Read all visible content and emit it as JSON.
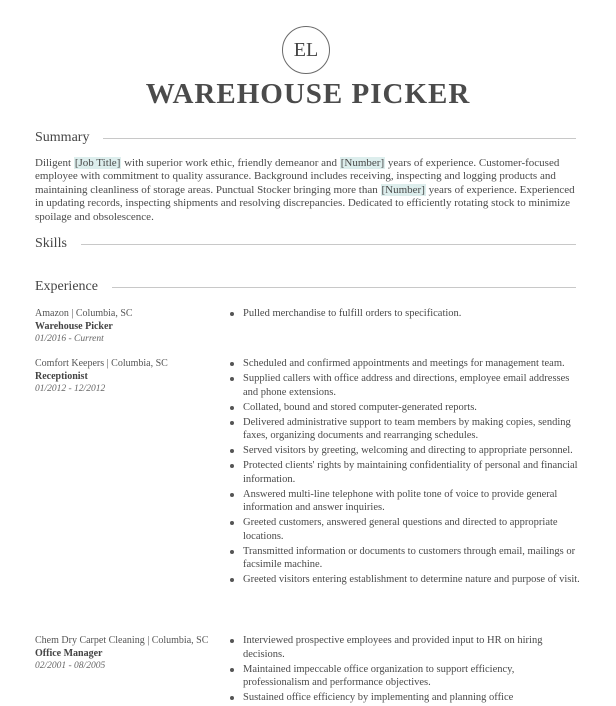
{
  "header": {
    "monogram": "EL",
    "title": "WAREHOUSE PICKER"
  },
  "sections": {
    "summary": "Summary",
    "skills": "Skills",
    "experience": "Experience"
  },
  "summary": {
    "parts": [
      "Diligent ",
      "[Job Title]",
      " with superior work ethic, friendly demeanor and ",
      "[Number]",
      " years of experience. Customer-focused employee with commitment to quality assurance. Background includes receiving, inspecting and logging products and maintaining cleanliness of storage areas. Punctual Stocker bringing more than ",
      "[Number]",
      " years of experience. Experienced in updating records, inspecting shipments and resolving discrepancies. Dedicated to efficiently rotating stock to minimize spoilage and obsolescence."
    ]
  },
  "experience": [
    {
      "company": "Amazon | Columbia, SC",
      "role": "Warehouse Picker",
      "dates": "01/2016 - Current",
      "bullets": [
        "Pulled merchandise to fulfill orders to specification."
      ]
    },
    {
      "company": "Comfort Keepers | Columbia, SC",
      "role": "Receptionist",
      "dates": "01/2012 - 12/2012",
      "bullets": [
        "Scheduled and confirmed appointments and meetings for management team.",
        "Supplied callers with office address and directions, employee email addresses and phone extensions.",
        "Collated, bound and stored computer-generated reports.",
        "Delivered administrative support to team members by making copies, sending faxes, organizing documents and rearranging schedules.",
        "Served visitors by greeting, welcoming and directing to appropriate personnel.",
        "Protected clients' rights by maintaining confidentiality of personal and financial information.",
        "Answered multi-line telephone with polite tone of voice to provide general information and answer inquiries.",
        "Greeted customers, answered general questions and directed to appropriate locations.",
        "Transmitted information or documents to customers through email, mailings or facsimile machine.",
        "Greeted visitors entering establishment to determine nature and purpose of visit."
      ]
    },
    {
      "company": "Chem Dry Carpet Cleaning | Columbia, SC",
      "role": "Office Manager",
      "dates": "02/2001 - 08/2005",
      "bullets": [
        "Interviewed prospective employees and provided input to HR on hiring decisions.",
        "Maintained impeccable office organization to support efficiency, professionalism and performance objectives.",
        "Sustained office efficiency by implementing and planning office"
      ]
    }
  ]
}
